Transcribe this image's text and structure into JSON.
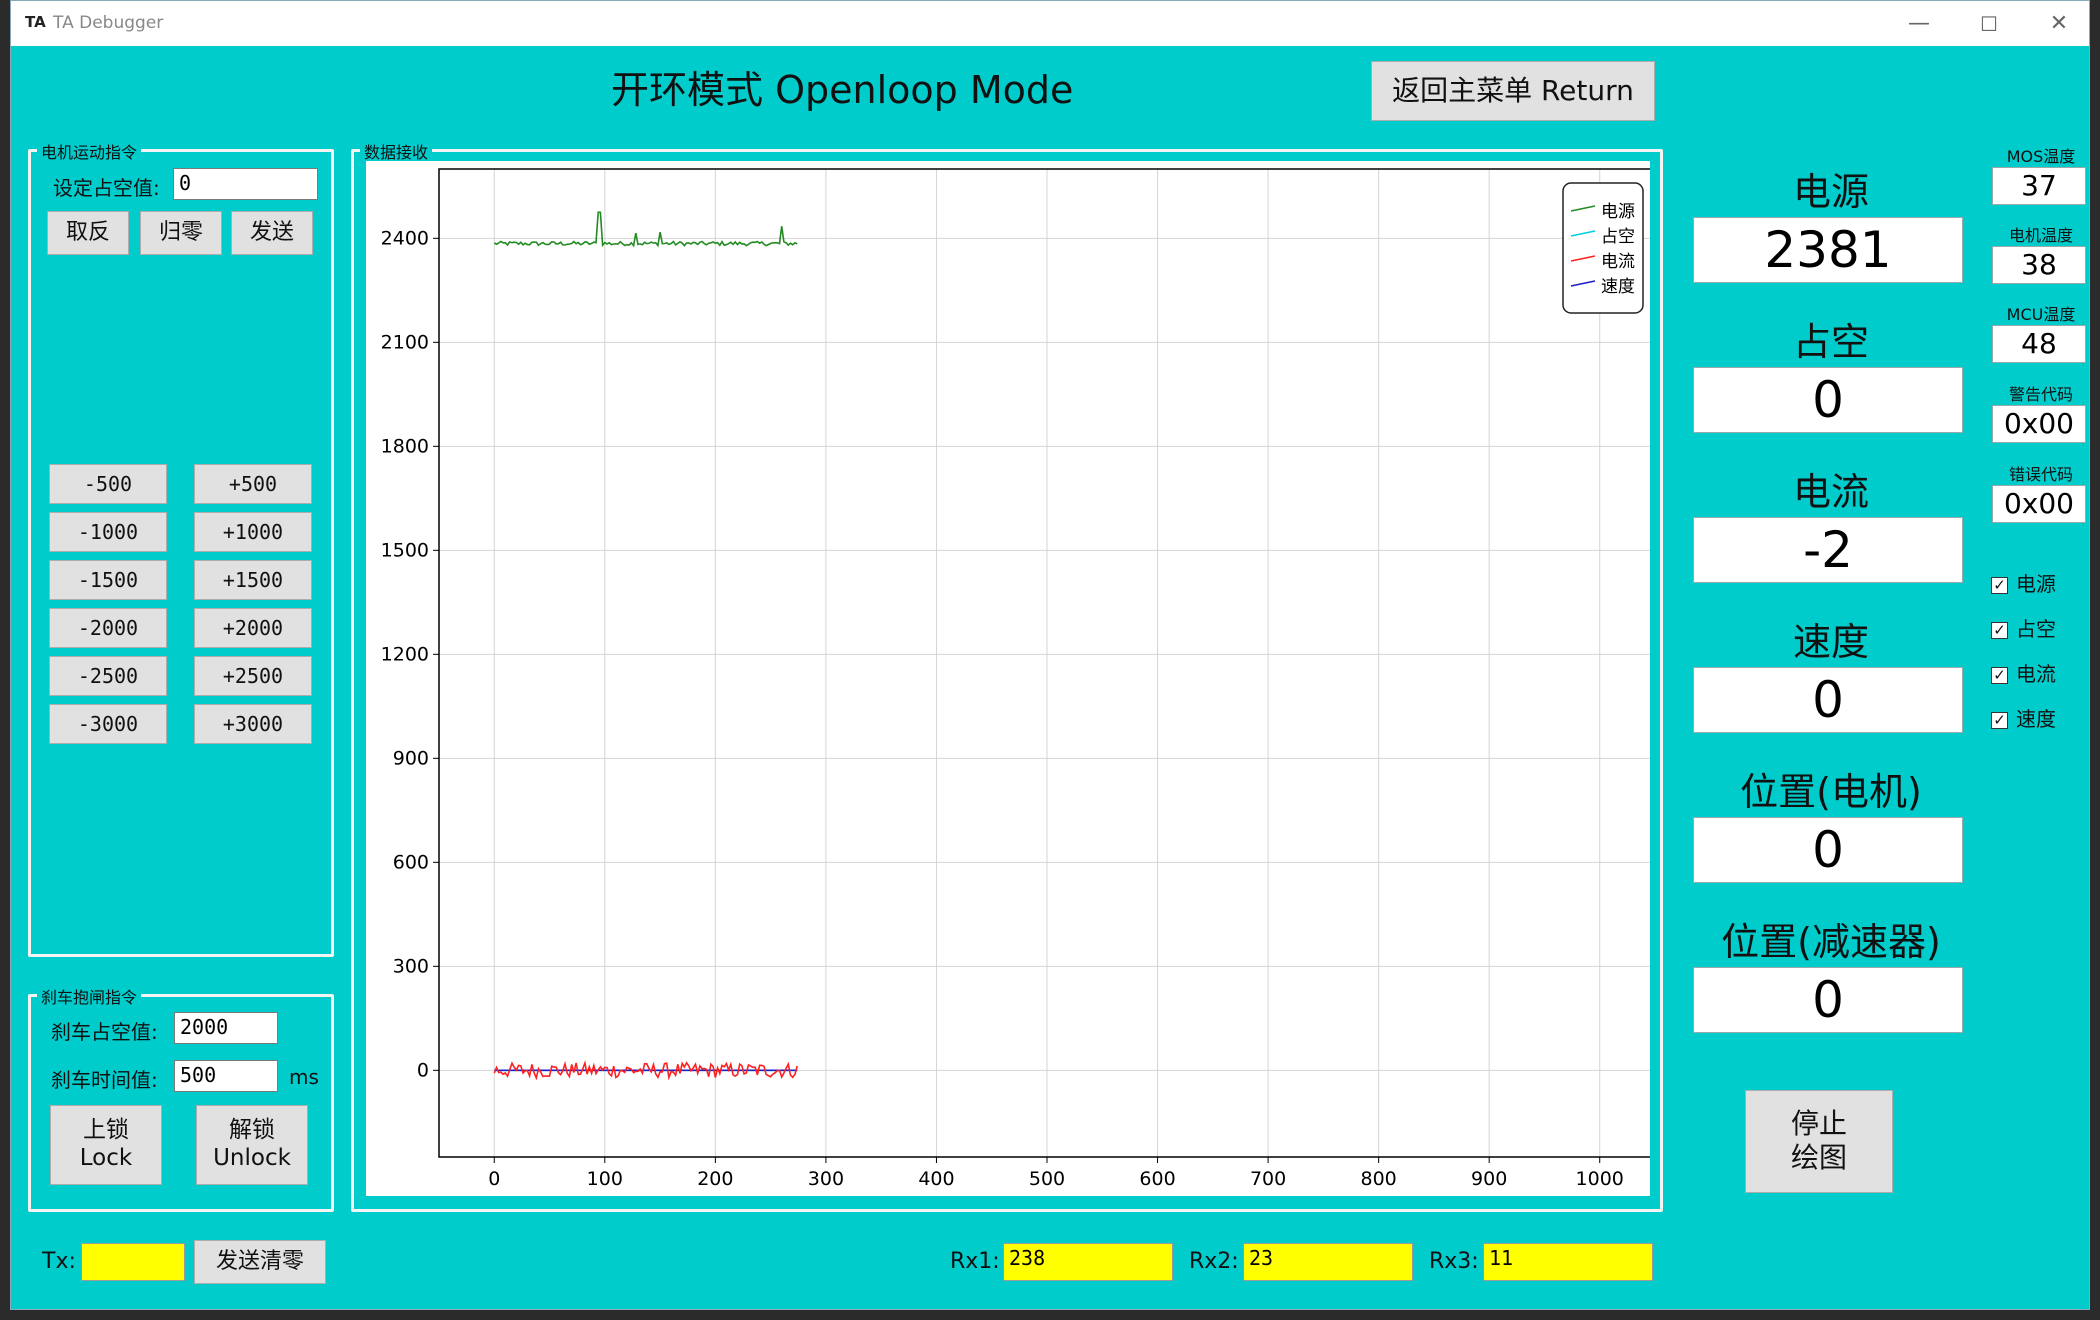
{
  "window": {
    "app_icon": "TA",
    "title": "TA Debugger",
    "min_glyph": "—",
    "max_glyph": "☐",
    "close_glyph": "✕"
  },
  "header": {
    "title": "开环模式 Openloop Mode",
    "return_button": "返回主菜单 Return"
  },
  "motor_group": {
    "label": "电机运动指令",
    "duty_label": "设定占空值:",
    "duty_value": "0",
    "invert_button": "取反",
    "zero_button": "归零",
    "send_button": "发送",
    "step_buttons": [
      [
        "-500",
        "+500"
      ],
      [
        "-1000",
        "+1000"
      ],
      [
        "-1500",
        "+1500"
      ],
      [
        "-2000",
        "+2000"
      ],
      [
        "-2500",
        "+2500"
      ],
      [
        "-3000",
        "+3000"
      ]
    ]
  },
  "brake_group": {
    "label": "刹车抱闸指令",
    "duty_label": "刹车占空值:",
    "duty_value": "2000",
    "time_label": "刹车时间值:",
    "time_value": "500",
    "time_unit": "ms",
    "lock_button_line1": "上锁",
    "lock_button_line2": "Lock",
    "unlock_button_line1": "解锁",
    "unlock_button_line2": "Unlock"
  },
  "chart_group": {
    "label": "数据接收"
  },
  "chart_data": {
    "type": "line",
    "xlim": [
      -50,
      1050
    ],
    "ylim": [
      -250,
      2600
    ],
    "x_ticks": [
      0,
      100,
      200,
      300,
      400,
      500,
      600,
      700,
      800,
      900,
      1000
    ],
    "y_ticks": [
      0,
      300,
      600,
      900,
      1200,
      1500,
      1800,
      2100,
      2400
    ],
    "grid": true,
    "legend_position": "top-right",
    "series": [
      {
        "name": "电源",
        "color": "#228b22",
        "x_range": [
          0,
          274
        ],
        "base": 2385,
        "noise": 6,
        "spikes": [
          [
            95,
            2475
          ],
          [
            128,
            2415
          ],
          [
            150,
            2418
          ],
          [
            260,
            2435
          ]
        ]
      },
      {
        "name": "占空",
        "color": "#00d0e0",
        "x_range": [
          0,
          274
        ],
        "base": 0,
        "noise": 0,
        "spikes": []
      },
      {
        "name": "电流",
        "color": "#ff2020",
        "x_range": [
          0,
          274
        ],
        "base": 0,
        "noise": 22,
        "spikes": []
      },
      {
        "name": "速度",
        "color": "#1e1ec8",
        "x_range": [
          0,
          274
        ],
        "base": 0,
        "noise": 0,
        "spikes": []
      }
    ]
  },
  "readouts": [
    {
      "label": "电源",
      "value": "2381"
    },
    {
      "label": "占空",
      "value": "0"
    },
    {
      "label": "电流",
      "value": "-2"
    },
    {
      "label": "速度",
      "value": "0"
    },
    {
      "label": "位置(电机)",
      "value": "0"
    },
    {
      "label": "位置(减速器)",
      "value": "0"
    }
  ],
  "status": [
    {
      "label": "MOS温度",
      "value": "37"
    },
    {
      "label": "电机温度",
      "value": "38"
    },
    {
      "label": "MCU温度",
      "value": "48"
    },
    {
      "label": "警告代码",
      "value": "0x00"
    },
    {
      "label": "错误代码",
      "value": "0x00"
    }
  ],
  "checkboxes": [
    {
      "label": "电源",
      "checked": "✓"
    },
    {
      "label": "占空",
      "checked": "✓"
    },
    {
      "label": "电流",
      "checked": "✓"
    },
    {
      "label": "速度",
      "checked": "✓"
    }
  ],
  "stop_button": {
    "line1": "停止",
    "line2": "绘图"
  },
  "footer": {
    "tx_label": "Tx:",
    "tx_value": "",
    "clear_button": "发送清零",
    "rx1_label": "Rx1:",
    "rx1_value": "238",
    "rx2_label": "Rx2:",
    "rx2_value": "23",
    "rx3_label": "Rx3:",
    "rx3_value": "11"
  }
}
